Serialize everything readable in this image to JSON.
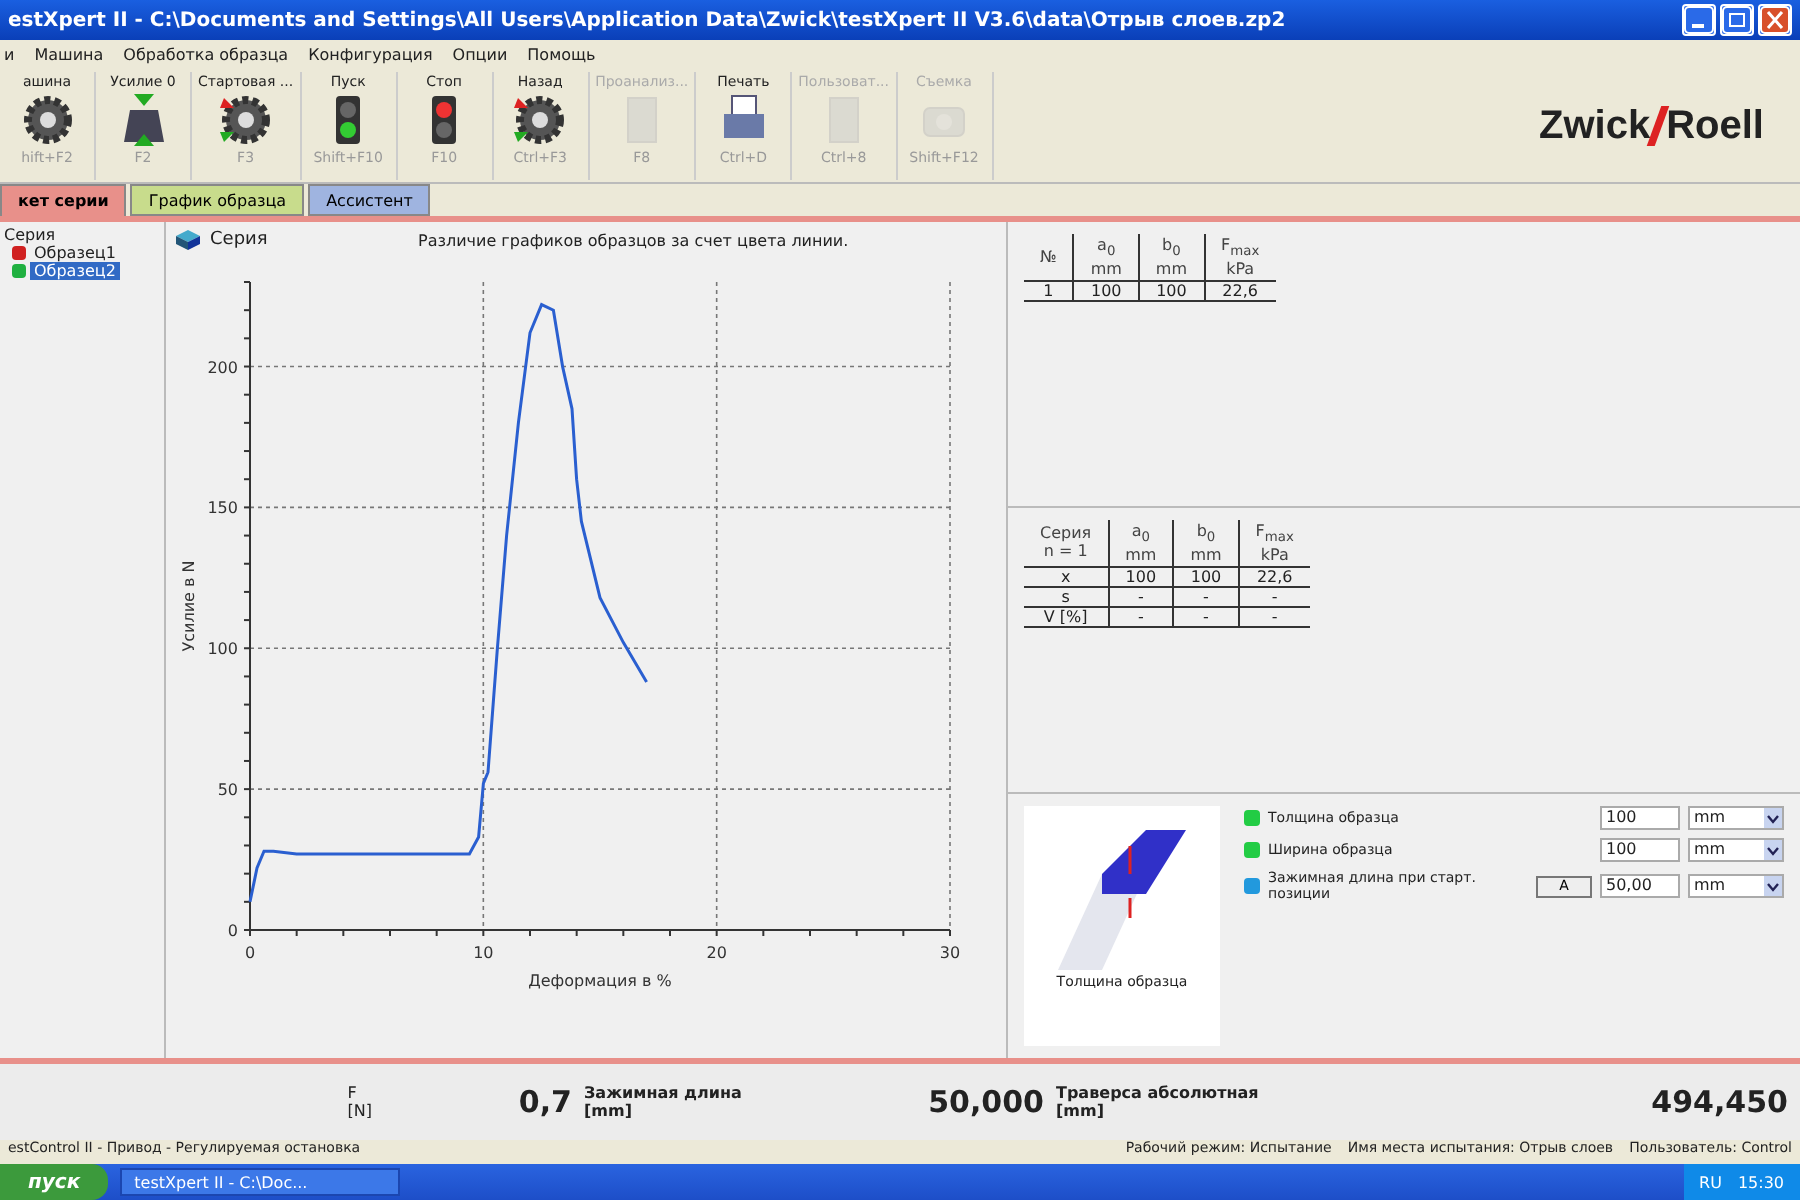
{
  "window": {
    "title": "estXpert II - C:\\Documents and Settings\\All Users\\Application Data\\Zwick\\testXpert II V3.6\\data\\Отрыв слоев.zp2"
  },
  "menu": [
    "и",
    "Машина",
    "Обработка образца",
    "Конфигурация",
    "Опции",
    "Помощь"
  ],
  "toolbar": [
    {
      "label": "ашина",
      "key": "hift+F2",
      "kind": "gear",
      "disabled": false
    },
    {
      "label": "Усилие 0",
      "key": "F2",
      "kind": "weight",
      "disabled": false
    },
    {
      "label": "Стартовая ...",
      "key": "F3",
      "kind": "gear-arrows",
      "disabled": false
    },
    {
      "label": "Пуск",
      "key": "Shift+F10",
      "kind": "go",
      "disabled": false
    },
    {
      "label": "Стоп",
      "key": "F10",
      "kind": "stop",
      "disabled": false
    },
    {
      "label": "Назад",
      "key": "Ctrl+F3",
      "kind": "gear-arrows",
      "disabled": false
    },
    {
      "label": "Проанализ...",
      "key": "F8",
      "kind": "sheet",
      "disabled": true
    },
    {
      "label": "Печать",
      "key": "Ctrl+D",
      "kind": "printer",
      "disabled": false
    },
    {
      "label": "Пользоват...",
      "key": "Ctrl+8",
      "kind": "sheet",
      "disabled": true
    },
    {
      "label": "Съемка",
      "key": "Shift+F12",
      "kind": "camera",
      "disabled": true
    }
  ],
  "logo": {
    "left": "Zwick",
    "right": "Roell"
  },
  "tabs": [
    {
      "label": "кет серии",
      "selected": true,
      "color": "#e8908a"
    },
    {
      "label": "График образца",
      "selected": false,
      "color": "#c8dc8c"
    },
    {
      "label": "Ассистент",
      "selected": false,
      "color": "#9fb4e0"
    }
  ],
  "tree": {
    "label": "Серия",
    "children": [
      {
        "label": "Образец1",
        "color": "#d02020",
        "selected": false
      },
      {
        "label": "Образец2",
        "color": "#20b040",
        "selected": true
      }
    ]
  },
  "chart_panel": {
    "heading": "Серия",
    "chart_data": {
      "type": "line",
      "grid": true,
      "title": "Различие графиков образцов за счет цвета линии.",
      "xlabel": "Деформация в %",
      "ylabel": "Усилие в N",
      "xlim": [
        0,
        30
      ],
      "ylim": [
        0,
        230
      ],
      "xticks": [
        0,
        10,
        20,
        30
      ],
      "yticks": [
        0,
        50,
        100,
        150,
        200
      ],
      "x": [
        0,
        0.3,
        0.6,
        1,
        2,
        5,
        9.4,
        9.8,
        10,
        10.2,
        10.6,
        11,
        11.5,
        12,
        12.5,
        13,
        13.4,
        13.8,
        14,
        14.2,
        15,
        16,
        17
      ],
      "series": [
        {
          "color": "#2a5fd0",
          "values": [
            10,
            22,
            28,
            28,
            27,
            27,
            27,
            33,
            52,
            56,
            100,
            140,
            180,
            212,
            222,
            220,
            200,
            185,
            160,
            145,
            118,
            102,
            88
          ]
        }
      ]
    }
  },
  "results_table": {
    "columns": [
      {
        "symbol": "№"
      },
      {
        "symbol": "a$_{0}$",
        "unit": "mm"
      },
      {
        "symbol": "b$_{0}$",
        "unit": "mm"
      },
      {
        "symbol": "F$_{max}$",
        "unit": "kPa"
      }
    ],
    "rows": [
      [
        "1",
        "100",
        "100",
        "22,6"
      ]
    ]
  },
  "stats_table": {
    "columns": [
      {
        "symbol": "Серия",
        "unit": "n = 1"
      },
      {
        "symbol": "a$_{0}$",
        "unit": "mm"
      },
      {
        "symbol": "b$_{0}$",
        "unit": "mm"
      },
      {
        "symbol": "F$_{max}$",
        "unit": "kPa"
      }
    ],
    "rows": [
      [
        "x",
        "100",
        "100",
        "22,6"
      ],
      [
        "s",
        "-",
        "-",
        "-"
      ],
      [
        "V [%]",
        "-",
        "-",
        "-"
      ]
    ]
  },
  "specimen": {
    "caption": "Толщина образца"
  },
  "parameters": [
    {
      "label": "Толщина образца",
      "value": "100",
      "unit": "mm"
    },
    {
      "label": "Ширина образца",
      "value": "100",
      "unit": "mm"
    },
    {
      "label": "Зажимная длина при старт. позиции",
      "value": "50,00",
      "unit": "mm",
      "button": "A"
    }
  ],
  "readings": [
    {
      "name": "F",
      "unit": "[N]"
    },
    {
      "name": "Зажимная длина",
      "unit": "[mm]",
      "value": "0,7"
    },
    {
      "name": "Траверса абсолютная",
      "unit": "[mm]",
      "value": "50,000"
    },
    {
      "value": "494,450"
    }
  ],
  "status_bar": {
    "left": "estControl II - Привод - Регулируемая остановка",
    "right": [
      "Рабочий режим: Испытание",
      "Имя места испытания: Отрыв слоев",
      "Пользователь: Control"
    ]
  },
  "taskbar": {
    "start": "пуск",
    "tasks": [
      "testXpert II - C:\\Doc..."
    ],
    "language": "RU",
    "clock": "15:30"
  }
}
